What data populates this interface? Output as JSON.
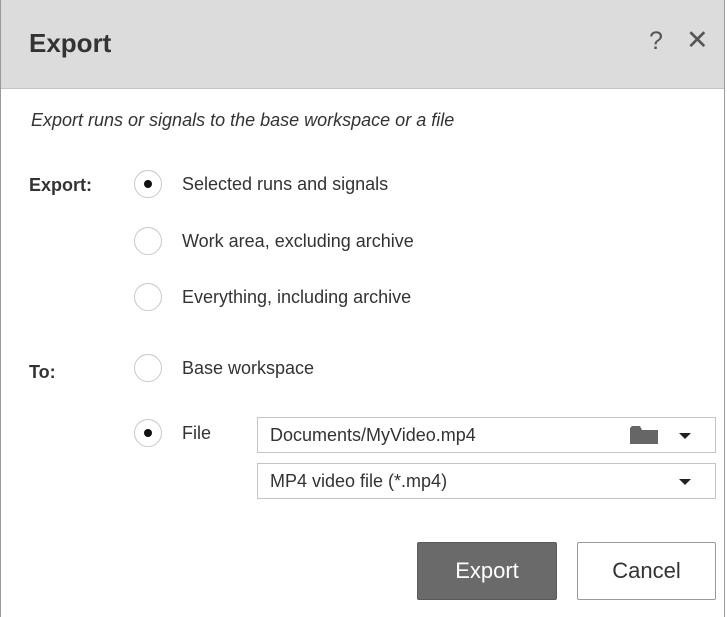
{
  "dialog": {
    "title": "Export",
    "help_glyph": "?",
    "close_glyph": "✕",
    "description": "Export runs or signals to the base workspace or a file"
  },
  "export_section": {
    "label": "Export:",
    "options": [
      {
        "label": "Selected runs and signals",
        "selected": true
      },
      {
        "label": "Work area, excluding archive",
        "selected": false
      },
      {
        "label": "Everything, including archive",
        "selected": false
      }
    ]
  },
  "to_section": {
    "label": "To:",
    "options": [
      {
        "label": "Base workspace",
        "selected": false
      },
      {
        "label": "File",
        "selected": true
      }
    ],
    "file_path": "Documents/MyVideo.mp4",
    "file_type": "MP4 video file (*.mp4)"
  },
  "buttons": {
    "export": "Export",
    "cancel": "Cancel"
  },
  "icons": {
    "folder": "folder-icon",
    "dropdown": "chevron-down-icon"
  },
  "colors": {
    "titlebar": "#dcdcdc",
    "primary_button": "#6a6a6a"
  }
}
